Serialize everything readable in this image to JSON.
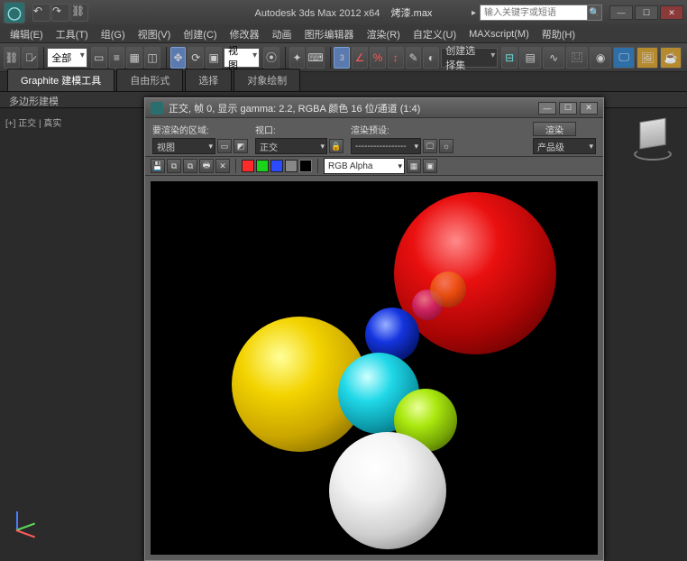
{
  "app": {
    "title_prefix": "Autodesk 3ds Max  2012 x64",
    "title_file": "烤漆.max",
    "search_placeholder": "输入关键字或短语"
  },
  "menu": {
    "items": [
      "编辑(E)",
      "工具(T)",
      "组(G)",
      "视图(V)",
      "创建(C)",
      "修改器",
      "动画",
      "图形编辑器",
      "渲染(R)",
      "自定义(U)",
      "MAXscript(M)",
      "帮助(H)"
    ]
  },
  "toolbar": {
    "scope_label": "全部",
    "view_label": "视图",
    "create_select_label": "创建选择集"
  },
  "ribbon": {
    "tabs": [
      "Graphite 建模工具",
      "自由形式",
      "选择",
      "对象绘制"
    ],
    "sub": "多边形建模"
  },
  "viewport": {
    "label": "[+] 正交 | 真实"
  },
  "render_window": {
    "title": "正交, 帧 0, 显示 gamma: 2.2, RGBA 颜色 16 位/通道 (1:4)",
    "area_label": "要渲染的区域:",
    "area_value": "视图",
    "viewport_label": "视口:",
    "viewport_value": "正交",
    "preset_label": "渲染预设:",
    "preset_value": "-----------------",
    "output_value": "产品级",
    "render_btn": "渲染",
    "channel_value": "RGB Alpha"
  },
  "icons": {
    "min": "—",
    "max": "☐",
    "close": "✕",
    "dropdown": "▾",
    "undo": "↶",
    "redo": "↷",
    "cog": "⚙",
    "disk": "💾",
    "copy": "⧉",
    "open": "📂",
    "lock": "🔒"
  }
}
